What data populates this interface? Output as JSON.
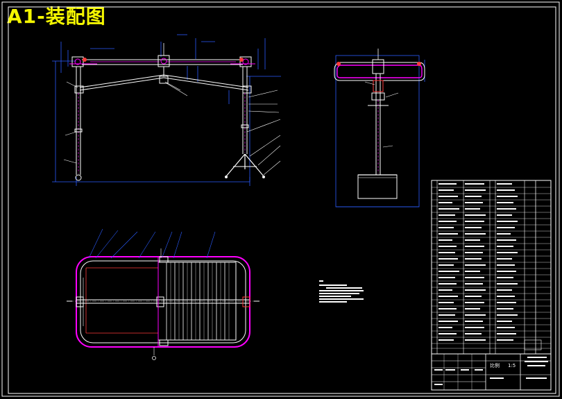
{
  "drawing": {
    "title": "A1-装配图",
    "scale_label": "比例",
    "scale_value": "1:5"
  },
  "colors": {
    "background": "#000000",
    "frame": "#ffffff",
    "part_outline": "#ffffff",
    "dimension": "#2b5cff",
    "hidden": "#ff00ff",
    "section": "#ff3b3b",
    "title": "#f4f600"
  }
}
